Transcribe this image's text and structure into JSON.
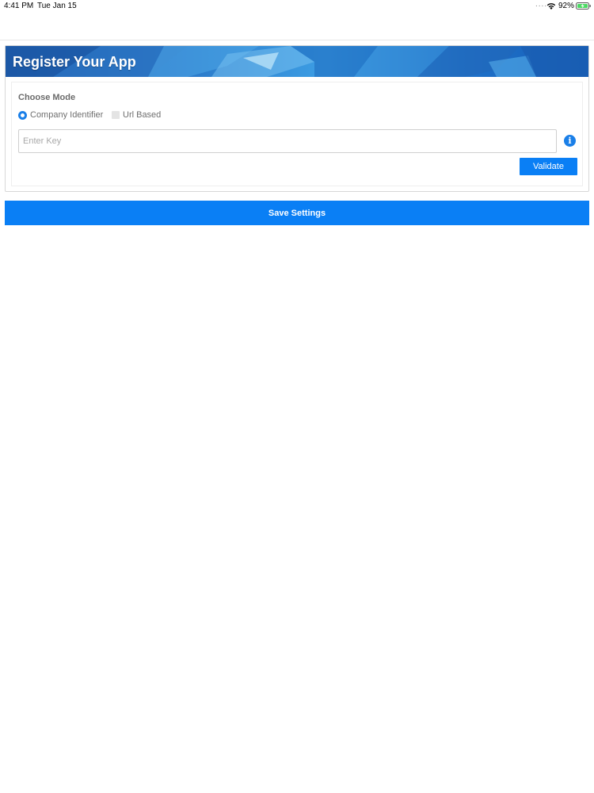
{
  "status_bar": {
    "time": "4:41 PM",
    "date": "Tue Jan 15",
    "signal_dots": "....",
    "battery_percent": "92%"
  },
  "register": {
    "title": "Register Your App",
    "choose_mode_label": "Choose Mode",
    "modes": [
      {
        "label": "Company Identifier",
        "selected": true
      },
      {
        "label": "Url Based",
        "selected": false
      }
    ],
    "key_input": {
      "placeholder": "Enter Key",
      "value": ""
    },
    "info_icon": "info-icon",
    "validate_label": "Validate"
  },
  "save_label": "Save Settings",
  "colors": {
    "accent": "#0a7ff5",
    "banner_blue": "#2a78c8"
  }
}
